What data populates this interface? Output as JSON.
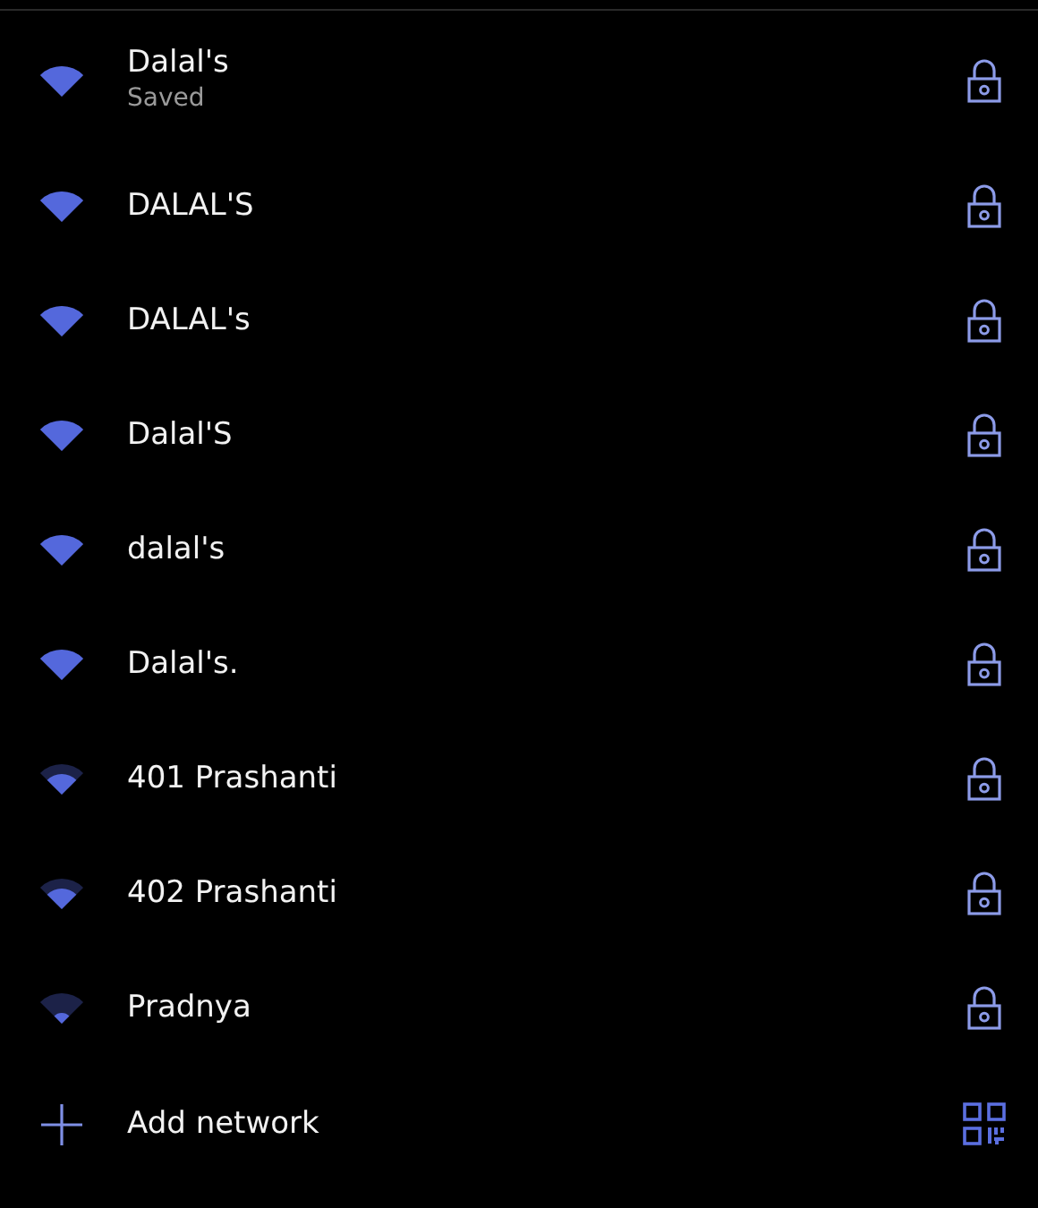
{
  "networks": [
    {
      "name": "Dalal's",
      "status": "Saved",
      "kind": "strong"
    },
    {
      "name": "DALAL'S",
      "kind": "strong"
    },
    {
      "name": "DALAL's",
      "kind": "strong"
    },
    {
      "name": "Dalal'S",
      "kind": "strong"
    },
    {
      "name": "dalal's",
      "kind": "strong"
    },
    {
      "name": "Dalal's.",
      "kind": "strong"
    },
    {
      "name": "401 Prashanti",
      "kind": "medium"
    },
    {
      "name": "402 Prashanti",
      "kind": "medium"
    },
    {
      "name": "Pradnya",
      "kind": "weak"
    }
  ],
  "add_network": {
    "label": "Add network"
  }
}
